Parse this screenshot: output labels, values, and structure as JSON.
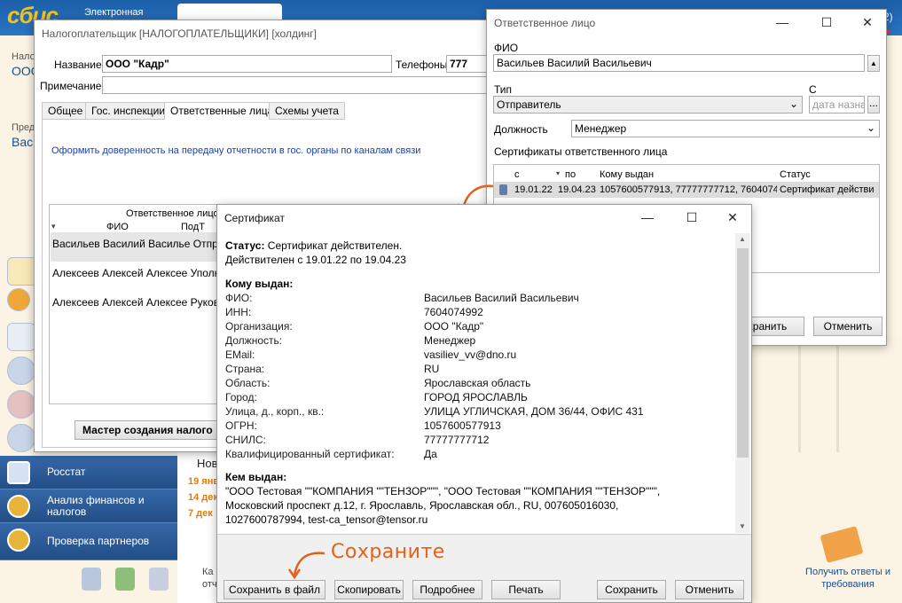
{
  "bg": {
    "logo": "сбис",
    "logo_sub": "Электронная",
    "left_label_1": "Нало",
    "left_value_1": "ООО",
    "left_label_2": "Пред",
    "left_value_2": "Вас",
    "nav": [
      "Росстат",
      "Анализ финансов и налогов",
      "Проверка партнеров"
    ],
    "news_title": "Нов",
    "news_dates": [
      "19 янв",
      "14 дек",
      "7 дек"
    ],
    "bottom_snippet_1": "Ка",
    "bottom_snippet_2": "отч",
    "help_text": "Получить ответы и требования",
    "badge_corner": "2)"
  },
  "taxpayer": {
    "title": "Налогоплательщик [НАЛОГОПЛАТЕЛЬЩИКИ] [холдинг]",
    "name_label": "Название",
    "name_value": "ООО \"Кадр\"",
    "phones_label": "Телефоны",
    "phones_value": "777",
    "note_label": "Примечание",
    "note_value": "",
    "tabs": [
      "Общее",
      "Гос. инспекции",
      "Ответственные лица",
      "Схемы учета"
    ],
    "link_text": "Оформить доверенность на передачу отчетности в гос. органы по каналам связи",
    "grid_header_group": "Ответственное лицо",
    "grid_col_fio": "ФИО",
    "grid_col_sign": "ПодТ",
    "rows": [
      {
        "fio": "Васильев Василий Василье",
        "role": "Отправ"
      },
      {
        "fio": "Алексеев Алексей Алексее",
        "role": "Уполно"
      },
      {
        "fio": "Алексеев Алексей Алексее",
        "role": "Руково"
      }
    ],
    "wizard_button": "Мастер создания налого"
  },
  "responsible": {
    "title": "Ответственное лицо",
    "fio_label": "ФИО",
    "fio_value": "Васильев Василий Васильевич",
    "type_label": "Тип",
    "type_value": "Отправитель",
    "from_label": "С",
    "from_placeholder": "дата назнач",
    "position_label": "Должность",
    "position_value": "Менеджер",
    "certs_label": "Сертификаты ответственного лица",
    "col_from": "с",
    "col_to": "по",
    "col_issued_to": "Кому выдан",
    "col_status": "Статус",
    "cert_row": {
      "from": "19.01.22",
      "to": "19.04.23",
      "issued_to": "1057600577913, 77777777712, 7604074",
      "status": "Сертификат действи"
    },
    "save_button": "хранить",
    "cancel_button": "Отменить"
  },
  "certificate": {
    "title": "Сертификат",
    "status_label": "Статус:",
    "status_value": "Сертификат действителен.",
    "valid_text": "Действителен с 19.01.22 по 19.04.23",
    "issued_to_header": "Кому выдан:",
    "fields": [
      {
        "k": "ФИО:",
        "v": "Васильев Василий Васильевич"
      },
      {
        "k": "ИНН:",
        "v": "7604074992"
      },
      {
        "k": "Организация:",
        "v": "ООО \"Кадр\""
      },
      {
        "k": "Должность:",
        "v": "Менеджер"
      },
      {
        "k": "EMail:",
        "v": "vasiliev_vv@dno.ru"
      },
      {
        "k": "Страна:",
        "v": "RU"
      },
      {
        "k": "Область:",
        "v": "Ярославская область"
      },
      {
        "k": "Город:",
        "v": "ГОРОД ЯРОСЛАВЛЬ"
      },
      {
        "k": "Улица, д., корп., кв.:",
        "v": "УЛИЦА УГЛИЧСКАЯ, ДОМ 36/44, ОФИС 431"
      },
      {
        "k": "ОГРН:",
        "v": "1057600577913"
      },
      {
        "k": "СНИЛС:",
        "v": "77777777712"
      },
      {
        "k": "Квалифицированный сертификат:",
        "v": "Да"
      }
    ],
    "issuer_header": "Кем выдан:",
    "issuer_lines": [
      "\"ООО Тестовая \"\"КОМПАНИЯ \"\"ТЕНЗОР\"\"\", \"ООО Тестовая \"\"КОМПАНИЯ \"\"ТЕНЗОР\"\"\",",
      "Московский проспект д.12, г. Ярославль, Ярославская обл., RU, 007605016030,",
      "1027600787994, test-ca_tensor@tensor.ru"
    ],
    "buttons": {
      "save_file": "Сохранить в файл",
      "copy": "Скопировать",
      "details": "Подробнее",
      "print": "Печать",
      "save": "Сохранить",
      "cancel": "Отменить"
    },
    "annotation": "Сохраните"
  }
}
